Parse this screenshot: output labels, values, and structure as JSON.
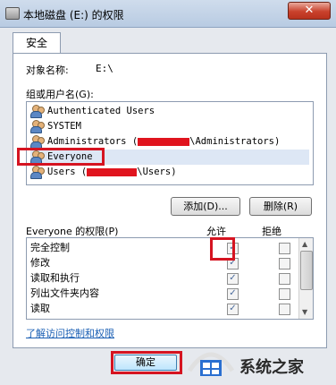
{
  "window": {
    "title": "本地磁盘 (E:) 的权限",
    "close_label": "✕"
  },
  "tabs": [
    {
      "label": "安全"
    }
  ],
  "object": {
    "label": "对象名称:",
    "value": "E:\\"
  },
  "groups": {
    "label": "组或用户名(G):",
    "items": [
      {
        "name": "Authenticated Users",
        "suffix": ""
      },
      {
        "name": "SYSTEM",
        "suffix": ""
      },
      {
        "name": "Administrators (",
        "suffix": "\\Administrators)"
      },
      {
        "name": "Everyone",
        "suffix": ""
      },
      {
        "name": "Users (",
        "suffix": "\\Users)"
      }
    ],
    "selected_index": 3
  },
  "buttons": {
    "add": "添加(D)...",
    "remove": "删除(R)"
  },
  "permissions": {
    "header": "Everyone 的权限(P)",
    "allow_label": "允许",
    "deny_label": "拒绝",
    "rows": [
      {
        "name": "完全控制",
        "allow": "✓",
        "deny": ""
      },
      {
        "name": "修改",
        "allow": "✓",
        "deny": ""
      },
      {
        "name": "读取和执行",
        "allow": "✓",
        "deny": ""
      },
      {
        "name": "列出文件夹内容",
        "allow": "✓",
        "deny": ""
      },
      {
        "name": "读取",
        "allow": "✓",
        "deny": ""
      }
    ]
  },
  "link_text": "了解访问控制和权限",
  "ok_label": "确定",
  "watermark": {
    "text": "系统之家"
  },
  "colors": {
    "highlight": "#d51421",
    "selection": "#dde7f5",
    "link": "#1a5fb4"
  }
}
